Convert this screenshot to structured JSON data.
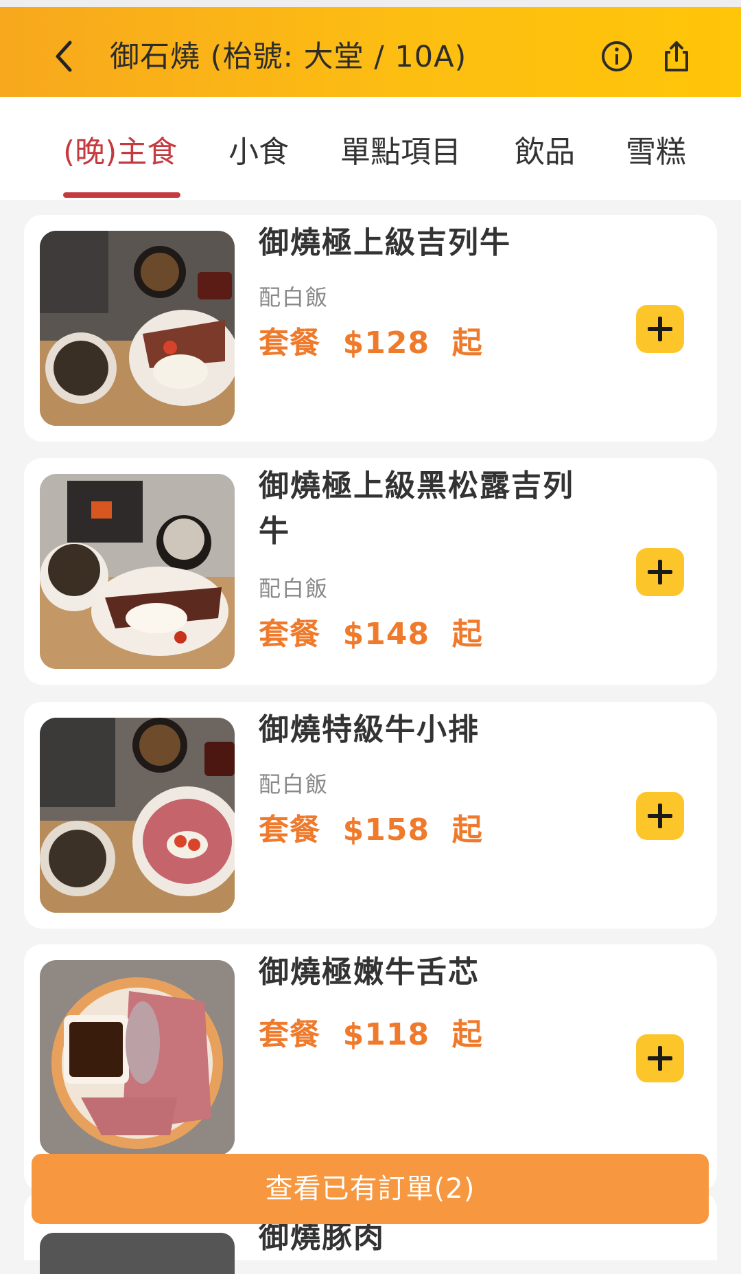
{
  "header": {
    "title": "御石燒 (枱號: 大堂 / 10A)",
    "back_icon": "chevron-left-icon",
    "info_icon": "info-icon",
    "share_icon": "share-icon"
  },
  "tabs": [
    {
      "label": "(晚)主食",
      "active": true
    },
    {
      "label": "小食"
    },
    {
      "label": "單點項目"
    },
    {
      "label": "飲品"
    },
    {
      "label": "雪糕"
    }
  ],
  "items": [
    {
      "name": "御燒極上級吉列牛",
      "sub": "配白飯",
      "price_prefix": "套餐",
      "price": "$128",
      "price_suffix": "起"
    },
    {
      "name": "御燒極上級黑松露吉列牛",
      "sub": "配白飯",
      "price_prefix": "套餐",
      "price": "$148",
      "price_suffix": "起"
    },
    {
      "name": "御燒特級牛小排",
      "sub": "配白飯",
      "price_prefix": "套餐",
      "price": "$158",
      "price_suffix": "起"
    },
    {
      "name": "御燒極嫩牛舌芯",
      "price_prefix": "套餐",
      "price": "$118",
      "price_suffix": "起"
    },
    {
      "name": "御燒豚肉"
    }
  ],
  "order_bar": {
    "label": "查看已有訂單(2)"
  },
  "colors": {
    "accent_red": "#c53a3f",
    "price_orange": "#ef7a2b",
    "add_yellow": "#fcc62b",
    "order_orange": "#f7973f"
  }
}
